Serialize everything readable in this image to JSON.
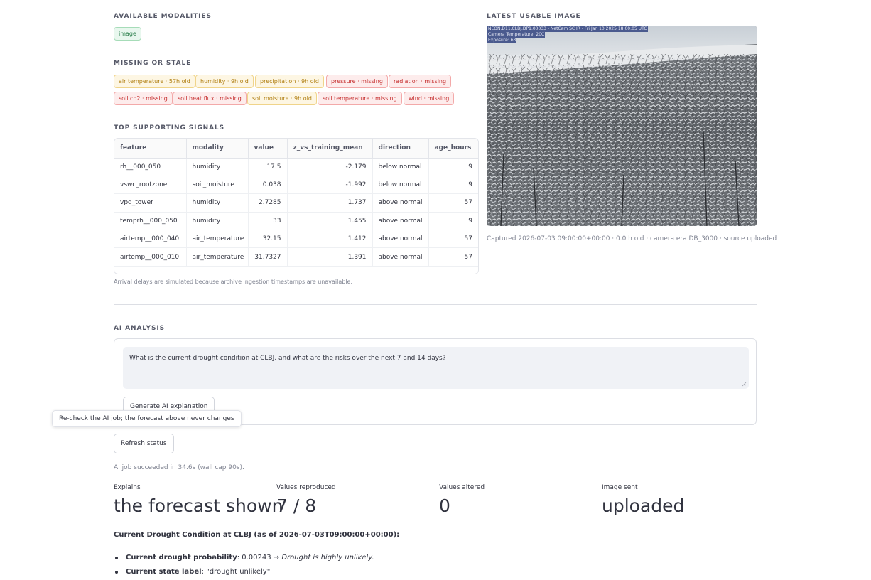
{
  "modalities": {
    "title": "AVAILABLE MODALITIES",
    "items": [
      {
        "label": "image"
      }
    ]
  },
  "missing": {
    "title": "MISSING OR STALE",
    "items": [
      {
        "label": "air temperature · 57h old",
        "status": "stale"
      },
      {
        "label": "humidity · 9h old",
        "status": "stale"
      },
      {
        "label": "precipitation · 9h old",
        "status": "stale"
      },
      {
        "label": "pressure · missing",
        "status": "missing"
      },
      {
        "label": "radiation · missing",
        "status": "missing"
      },
      {
        "label": "soil co2 · missing",
        "status": "missing"
      },
      {
        "label": "soil heat flux · missing",
        "status": "missing"
      },
      {
        "label": "soil moisture · 9h old",
        "status": "stale"
      },
      {
        "label": "soil temperature · missing",
        "status": "missing"
      },
      {
        "label": "wind · missing",
        "status": "missing"
      }
    ]
  },
  "signals": {
    "title": "TOP SUPPORTING SIGNALS",
    "columns": [
      "feature",
      "modality",
      "value",
      "z_vs_training_mean",
      "direction",
      "age_hours"
    ],
    "rows": [
      [
        "rh__000_050",
        "humidity",
        "17.5",
        "-2.179",
        "below normal",
        "9"
      ],
      [
        "vswc_rootzone",
        "soil_moisture",
        "0.038",
        "-1.992",
        "below normal",
        "9"
      ],
      [
        "vpd_tower",
        "humidity",
        "2.7285",
        "1.737",
        "above normal",
        "57"
      ],
      [
        "temprh__000_050",
        "humidity",
        "33",
        "1.455",
        "above normal",
        "9"
      ],
      [
        "airtemp__000_040",
        "air_temperature",
        "32.15",
        "1.412",
        "above normal",
        "57"
      ],
      [
        "airtemp__000_010",
        "air_temperature",
        "31.7327",
        "1.391",
        "above normal",
        "57"
      ]
    ],
    "note": "Arrival delays are simulated because archive ingestion timestamps are unavailable."
  },
  "image": {
    "title": "LATEST USABLE IMAGE",
    "overlay_line1": "NEON.D11.CLBJ.DP1.00033 - NetCam SC IR - Fri Jan 10 2025 18:00:05 UTC",
    "overlay_line2": "Camera Temperature: 20C",
    "overlay_line3": "Exposure: 63",
    "caption": "Captured 2026-07-03 09:00:00+00:00 · 0.0 h old · camera era DB_3000 · source uploaded"
  },
  "ai": {
    "title": "AI ANALYSIS",
    "question": "What is the current drought condition at CLBJ, and what are the risks over the next 7 and 14 days?",
    "generate_label": "Generate AI explanation",
    "tooltip": "Re-check the AI job; the forecast above never changes",
    "refresh_label": "Refresh status",
    "job_status": "AI job succeeded in 34.6s (wall cap 90s)."
  },
  "metrics": [
    {
      "label": "Explains",
      "value": "the forecast shown"
    },
    {
      "label": "Values reproduced",
      "value": "7 / 8"
    },
    {
      "label": "Values altered",
      "value": "0"
    },
    {
      "label": "Image sent",
      "value": "uploaded"
    }
  ],
  "summary": {
    "title": "Current Drought Condition at CLBJ (as of 2026-07-03T09:00:00+00:00):",
    "b1_key": "Current drought probability",
    "b1_val": ": 0.00243 → ",
    "b1_em": "Drought is highly unlikely.",
    "b2_key": "Current state label",
    "b2_val": ": \"drought unlikely\""
  },
  "colors": {
    "chip_green": "#237a45",
    "chip_amber": "#b07e10",
    "chip_red": "#c52c2c"
  }
}
